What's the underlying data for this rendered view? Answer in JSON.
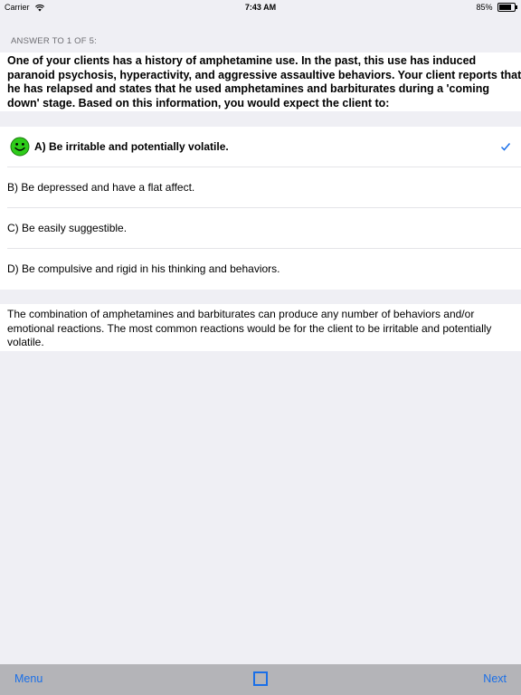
{
  "status_bar": {
    "carrier": "Carrier",
    "time": "7:43 AM",
    "battery": "85%"
  },
  "header": {
    "label": "ANSWER TO 1 OF 5:"
  },
  "question": {
    "lines": [
      "One of your clients has a history of amphetamine use. In the past, this use has induced",
      "paranoid psychosis, hyperactivity, and aggressive assaultive behaviors. Your client reports that",
      "he has relapsed and states that he used amphetamines and barbiturates during a 'coming",
      "down' stage. Based on this information, you would expect the client to:"
    ]
  },
  "answers": [
    {
      "label": "A) Be irritable and potentially volatile.",
      "correct": true,
      "selected": true
    },
    {
      "label": "B) Be depressed and have a flat affect.",
      "correct": false,
      "selected": false
    },
    {
      "label": "C) Be easily suggestible.",
      "correct": false,
      "selected": false
    },
    {
      "label": "D) Be compulsive and rigid in his thinking and behaviors.",
      "correct": false,
      "selected": false
    }
  ],
  "explanation": {
    "text": "The combination of amphetamines and barbiturates can produce any number of behaviors and/or emotional reactions. The most common reactions would be for the client to be irritable and potentially volatile."
  },
  "toolbar": {
    "menu_label": "Menu",
    "next_label": "Next",
    "mark_icon": "checkbox-empty-icon"
  },
  "colors": {
    "accent": "#1a6fe8",
    "smiley": "#2ecc1a",
    "background": "#efeff4",
    "toolbar": "#b4b4b8"
  }
}
